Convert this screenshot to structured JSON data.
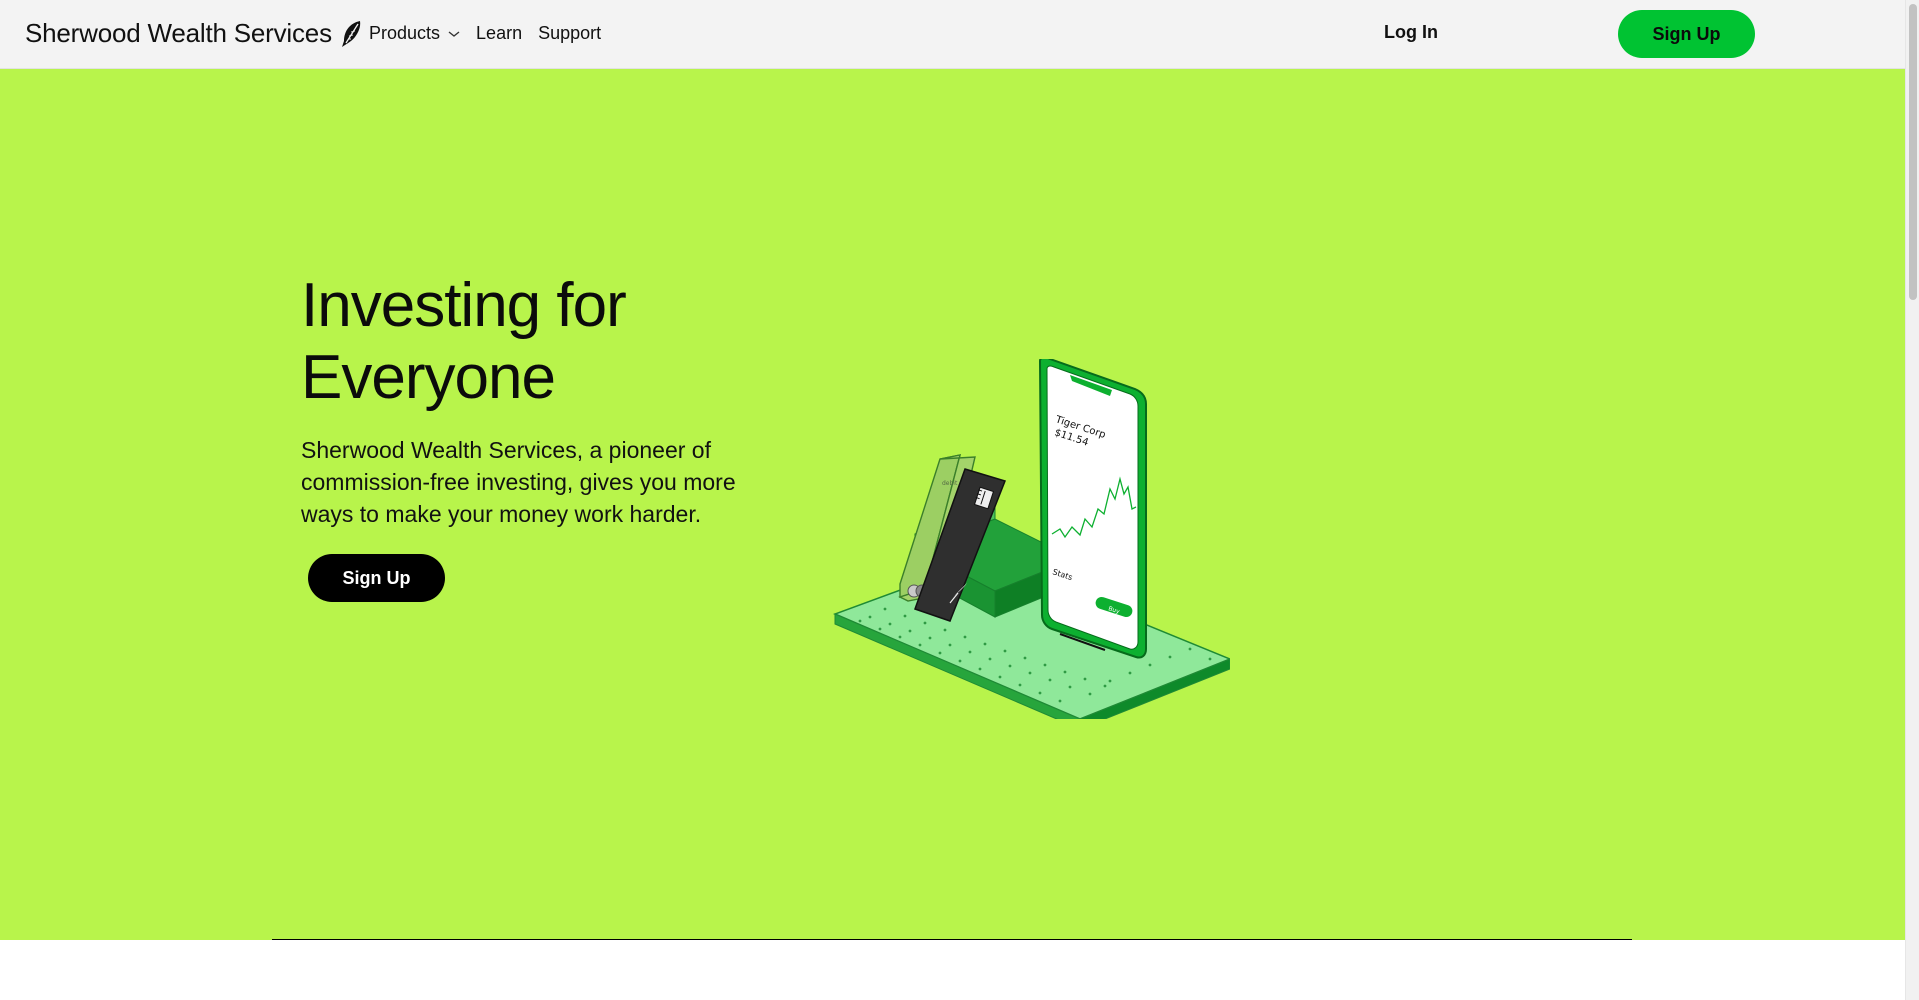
{
  "header": {
    "brand_name": "Sherwood Wealth Services",
    "nav": {
      "products_label": "Products",
      "learn_label": "Learn",
      "support_label": "Support"
    },
    "login_label": "Log In",
    "signup_label": "Sign Up"
  },
  "hero": {
    "title": "Investing for Everyone",
    "subtitle": "Sherwood Wealth Services, a pioneer of commission-free investing, gives you more ways to make your money work harder.",
    "signup_label": "Sign Up",
    "illustration": {
      "card_chip_label": "debit",
      "stock_name": "Tiger Corp",
      "stock_price": "$11.54",
      "stats_label": "Stats",
      "buy_label": "Buy"
    }
  },
  "colors": {
    "hero_background": "#b8f44b",
    "primary_green": "#00c332",
    "header_background": "#f3f3f3"
  },
  "icons": {
    "brand_logo": "feather-icon",
    "products_dropdown": "chevron-down-icon"
  }
}
